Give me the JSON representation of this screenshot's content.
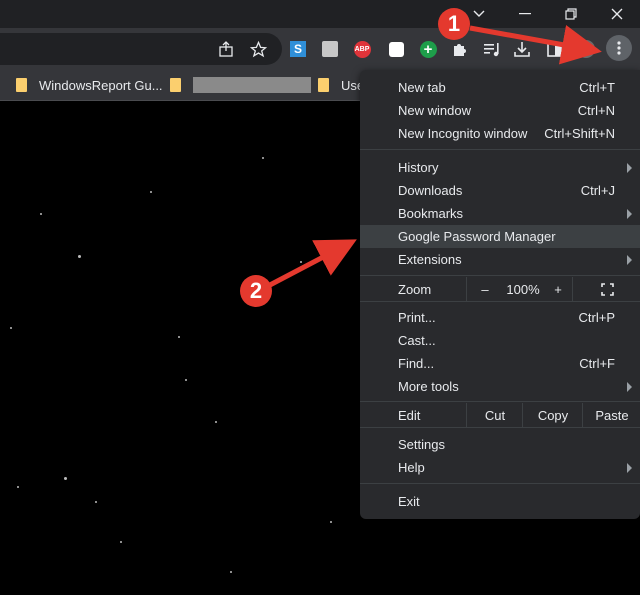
{
  "titlebar": {
    "minimize_icon": "chevron-down-icon",
    "restore_icon": "restore-icon",
    "close_icon": "close-icon"
  },
  "bookmarks": [
    {
      "label": "WindowsReport Gu..."
    },
    {
      "label": ""
    },
    {
      "label": "Use"
    }
  ],
  "menu": {
    "new_tab": {
      "label": "New tab",
      "shortcut": "Ctrl+T"
    },
    "new_window": {
      "label": "New window",
      "shortcut": "Ctrl+N"
    },
    "new_incognito": {
      "label": "New Incognito window",
      "shortcut": "Ctrl+Shift+N"
    },
    "history": {
      "label": "History"
    },
    "downloads": {
      "label": "Downloads",
      "shortcut": "Ctrl+J"
    },
    "bookmarks": {
      "label": "Bookmarks"
    },
    "password_manager": {
      "label": "Google Password Manager"
    },
    "extensions": {
      "label": "Extensions"
    },
    "zoom": {
      "label": "Zoom",
      "minus": "–",
      "value": "100%",
      "plus": "+"
    },
    "print": {
      "label": "Print...",
      "shortcut": "Ctrl+P"
    },
    "cast": {
      "label": "Cast..."
    },
    "find": {
      "label": "Find...",
      "shortcut": "Ctrl+F"
    },
    "more_tools": {
      "label": "More tools"
    },
    "edit": {
      "label": "Edit",
      "cut": "Cut",
      "copy": "Copy",
      "paste": "Paste"
    },
    "settings": {
      "label": "Settings"
    },
    "help": {
      "label": "Help"
    },
    "exit": {
      "label": "Exit"
    }
  },
  "annotations": {
    "step1": "1",
    "step2": "2",
    "color": "#e4392e"
  }
}
